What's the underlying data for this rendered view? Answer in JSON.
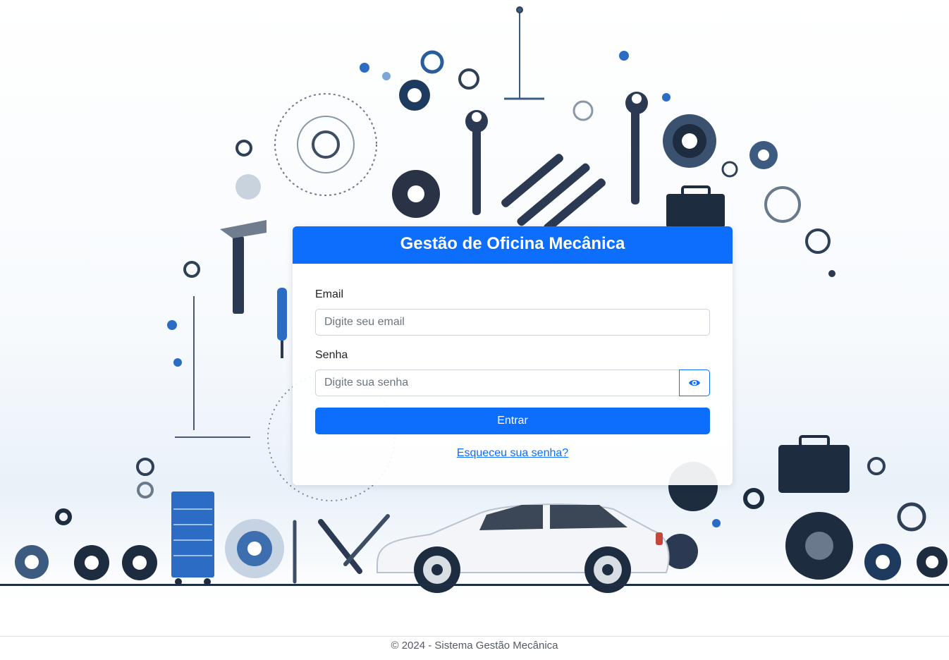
{
  "login": {
    "title": "Gestão de Oficina Mecânica",
    "email_label": "Email",
    "email_placeholder": "Digite seu email",
    "password_label": "Senha",
    "password_placeholder": "Digite sua senha",
    "toggle_icon": "eye-icon",
    "submit_label": "Entrar",
    "forgot_link": "Esqueceu sua senha?"
  },
  "footer": {
    "text": "© 2024 - Sistema Gestão Mecânica"
  },
  "colors": {
    "primary": "#0d6efd",
    "dark_tools": "#1d2e45",
    "accent_blue": "#3a7bd5"
  }
}
